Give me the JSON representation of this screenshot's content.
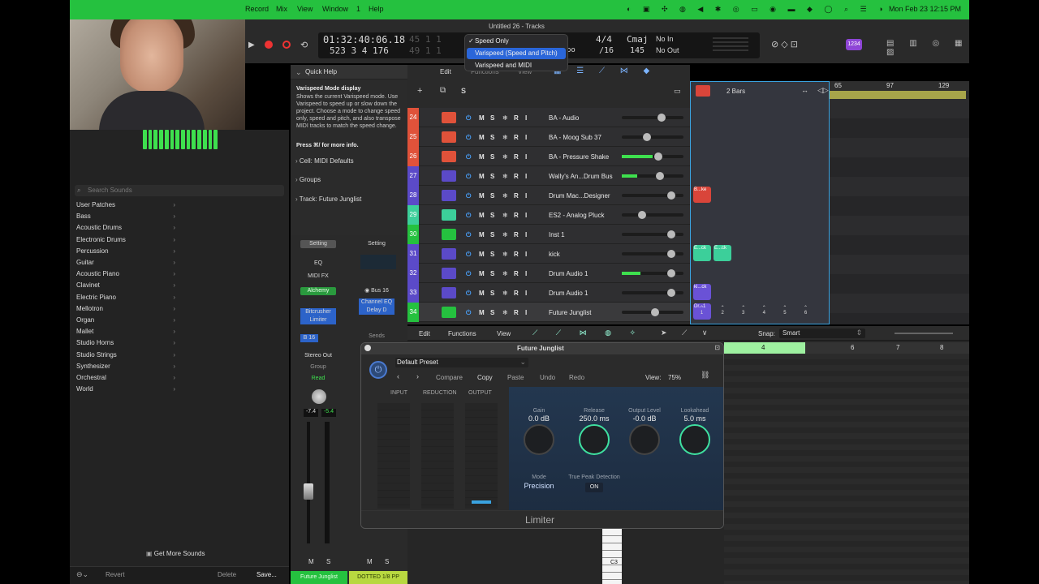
{
  "menubar": {
    "items": [
      "Record",
      "Mix",
      "View",
      "Window",
      "1",
      "Help"
    ],
    "clock": "Mon Feb 23  12:15 PM"
  },
  "window": {
    "title": "Untitled 26 - Tracks"
  },
  "lcd": {
    "time": "01:32:40:06.18",
    "bars": "523  3  4  176",
    "signature": "4/4",
    "division": "/16",
    "key": "Cmaj",
    "tempo": "145",
    "in": "No In",
    "out": "No Out",
    "tempo_label": "po"
  },
  "dropdown": {
    "options": [
      "Speed Only",
      "Varispeed (Speed and Pitch)",
      "Varispeed and MIDI"
    ],
    "checked": "Speed Only"
  },
  "quickhelp": {
    "header": "Quick Help",
    "title": "Varispeed Mode display",
    "body": "Shows the current Varispeed mode. Use Varispeed to speed up or slow down the project. Choose a mode to change speed only, speed and pitch, and also transpose MIDI tracks to match the speed change.",
    "more": "Press ⌘/ for more info.",
    "cell": "Cell:  MIDI Defaults",
    "groups": "Groups",
    "track": "Track:  Future Junglist"
  },
  "library": {
    "search_placeholder": "Search Sounds",
    "items": [
      "User Patches",
      "Bass",
      "Acoustic Drums",
      "Electronic Drums",
      "Percussion",
      "Guitar",
      "Acoustic Piano",
      "Clavinet",
      "Electric Piano",
      "Mellotron",
      "Organ",
      "Mallet",
      "Studio Horns",
      "Studio Strings",
      "Synthesizer",
      "Orchestral",
      "World"
    ],
    "get_more": "Get More Sounds",
    "revert": "Revert",
    "delete": "Delete",
    "save": "Save..."
  },
  "inspector": {
    "setting": "Setting",
    "eq": "EQ",
    "midi_fx": "MIDI FX",
    "alchemy": "Alchemy",
    "bitcrusher": "Bitcrusher",
    "limiter": "Limiter",
    "b16": "B 16",
    "stereo_out": "Stereo Out",
    "group": "Group",
    "read": "Read",
    "vol1": "-7.4",
    "vol2": "-5.4",
    "bus16": "Bus 16",
    "channel_eq": "Channel EQ",
    "delay_d": "Delay D",
    "sends": "Sends",
    "m": "M",
    "s": "S",
    "strip1_name": "Future Junglist",
    "strip2_name": "DOTTED 1/8 PP"
  },
  "tracks_toolbar": {
    "edit": "Edit",
    "functions": "Functions",
    "view": "View"
  },
  "tracks": [
    {
      "num": "24",
      "name": "BA - Audio",
      "color": "#e0523a"
    },
    {
      "num": "25",
      "name": "BA - Moog Sub 37",
      "color": "#e0523a"
    },
    {
      "num": "26",
      "name": "BA - Pressure Shake",
      "color": "#e0523a"
    },
    {
      "num": "27",
      "name": "Wally's An...Drum Bus",
      "color": "#5b4ac8"
    },
    {
      "num": "28",
      "name": "Drum Mac...Designer",
      "color": "#5b4ac8"
    },
    {
      "num": "29",
      "name": "ES2 - Analog Pluck",
      "color": "#3ccf9a"
    },
    {
      "num": "30",
      "name": "Inst 1",
      "color": "#25c13f"
    },
    {
      "num": "31",
      "name": "kick",
      "color": "#5b4ac8"
    },
    {
      "num": "32",
      "name": "Drum Audio 1",
      "color": "#5b4ac8"
    },
    {
      "num": "33",
      "name": "Drum Audio 1",
      "color": "#5b4ac8"
    },
    {
      "num": "34",
      "name": "Future Junglist",
      "color": "#25c13f"
    }
  ],
  "cellgrid": {
    "quantize": "2 Bars",
    "cells": [
      {
        "label": "B...ke",
        "row": 2,
        "col": 0,
        "color": "#d9453a"
      },
      {
        "label": "E...ck",
        "row": 5,
        "col": 0,
        "color": "#3ccf9a"
      },
      {
        "label": "E...ck",
        "row": 5,
        "col": 1,
        "color": "#3ccf9a"
      },
      {
        "label": "ki...ck",
        "row": 7,
        "col": 0,
        "color": "#6a52d6"
      },
      {
        "label": "Dr...1",
        "row": 8,
        "col": 0,
        "color": "#6a52d6"
      }
    ],
    "columns": [
      "1",
      "2",
      "3",
      "4",
      "5",
      "6"
    ]
  },
  "arrange": {
    "ruler": [
      "65",
      "97",
      "129"
    ]
  },
  "editor": {
    "edit": "Edit",
    "functions": "Functions",
    "view": "View",
    "snap_label": "Snap:",
    "snap_value": "Smart",
    "ruler": [
      "4",
      "6",
      "7",
      "8"
    ],
    "c3": "C3"
  },
  "plugin": {
    "title": "Future Junglist",
    "preset": "Default Preset",
    "compare": "Compare",
    "copy": "Copy",
    "paste": "Paste",
    "undo": "Undo",
    "redo": "Redo",
    "view_label": "View:",
    "view_value": "75%",
    "input": "INPUT",
    "reduction": "REDUCTION",
    "output": "OUTPUT",
    "gain_label": "Gain",
    "gain_value": "0.0 dB",
    "release_label": "Release",
    "release_value": "250.0 ms",
    "output_level_label": "Output Level",
    "output_level_value": "-0.0 dB",
    "lookahead_label": "Lookahead",
    "lookahead_value": "5.0 ms",
    "mode_label": "Mode",
    "mode_value": "Precision",
    "true_peak_label": "True Peak Detection",
    "true_peak_value": "ON",
    "name": "Limiter"
  }
}
